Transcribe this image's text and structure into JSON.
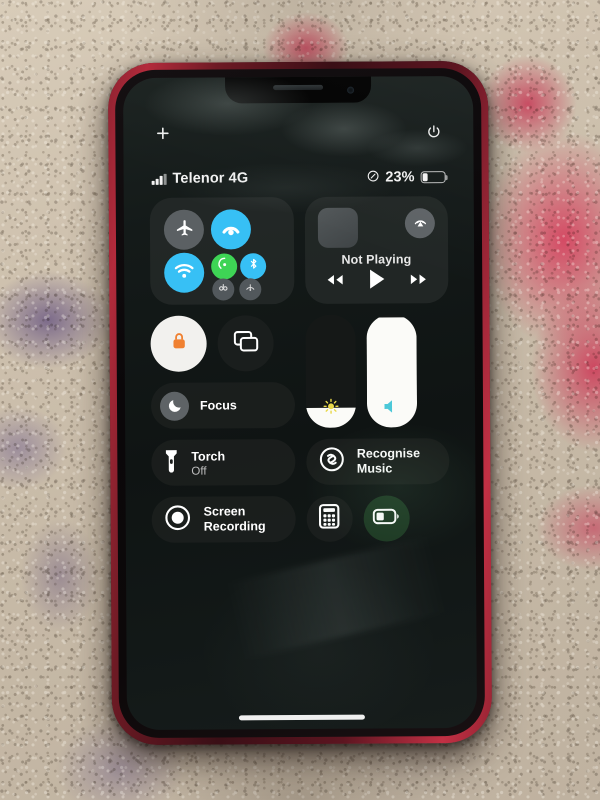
{
  "device": {
    "name": "iphone",
    "case_color": "#a32433",
    "frame_color": "#120a0c"
  },
  "hardware_icons": {
    "add_label": "+",
    "add_icon": "plus-icon",
    "power_icon": "power-icon",
    "speaker_icon": "earpiece-speaker",
    "camera_icon": "front-camera-icon"
  },
  "status_bar": {
    "signal_icon": "cellular-signal-icon",
    "carrier": "Telenor 4G",
    "focus_icon": "do-not-disturb-icon",
    "battery_percent": "23%",
    "battery_level": 23,
    "battery_icon": "battery-icon"
  },
  "control_center": {
    "connectivity": {
      "name": "connectivity-module",
      "toggles": [
        {
          "name": "airplane-mode",
          "icon": "airplane-icon",
          "state": "off",
          "color": "#5b6063"
        },
        {
          "name": "cellular-data",
          "icon": "cellular-data-icon",
          "state": "on",
          "color": "#37c0f5"
        },
        {
          "name": "wifi",
          "icon": "wifi-icon",
          "state": "on",
          "color": "#37c0f5"
        },
        {
          "name": "airdrop",
          "icon": "airdrop-icon",
          "state": "on",
          "color": "#3ed455"
        },
        {
          "name": "bluetooth",
          "icon": "bluetooth-icon",
          "state": "on",
          "color": "#37c0f5"
        },
        {
          "name": "personal-hotspot",
          "icon": "hotspot-icon",
          "state": "off",
          "color": "#52585c"
        },
        {
          "name": "vpn",
          "icon": "vpn-icon",
          "state": "off",
          "color": "#52585c"
        }
      ]
    },
    "media": {
      "name": "now-playing-module",
      "status": "Not Playing",
      "album_art_icon": "album-art-placeholder",
      "airplay_icon": "airplay-icon",
      "controls": [
        {
          "name": "rewind-button",
          "icon": "rewind-icon"
        },
        {
          "name": "play-button",
          "icon": "play-icon"
        },
        {
          "name": "forward-button",
          "icon": "fast-forward-icon"
        }
      ]
    },
    "rotation_lock": {
      "name": "rotation-lock-toggle",
      "icon": "lock-rotate-icon",
      "state": "on",
      "accent": "#f08030"
    },
    "screen_mirroring": {
      "name": "screen-mirroring-toggle",
      "icon": "screen-mirroring-icon",
      "state": "off"
    },
    "focus": {
      "name": "focus-tile",
      "label": "Focus",
      "icon": "moon-icon"
    },
    "brightness": {
      "name": "brightness-slider",
      "icon": "brightness-icon",
      "value": 18
    },
    "volume": {
      "name": "volume-slider",
      "icon": "speaker-volume-icon",
      "value": 97
    },
    "torch": {
      "name": "torch-tile",
      "label": "Torch",
      "sublabel": "Off",
      "icon": "flashlight-icon"
    },
    "recognise_music": {
      "name": "recognise-music-tile",
      "label_line1": "Recognise",
      "label_line2": "Music",
      "icon": "shazam-icon"
    },
    "screen_recording": {
      "name": "screen-recording-tile",
      "label_line1": "Screen",
      "label_line2": "Recording",
      "icon": "record-icon"
    },
    "calculator": {
      "name": "calculator-tile",
      "icon": "calculator-icon"
    },
    "low_power_mode": {
      "name": "low-power-mode-tile",
      "icon": "battery-low-power-icon",
      "state": "on",
      "color": "#1e3a24"
    }
  },
  "home_indicator": {
    "name": "home-indicator"
  }
}
